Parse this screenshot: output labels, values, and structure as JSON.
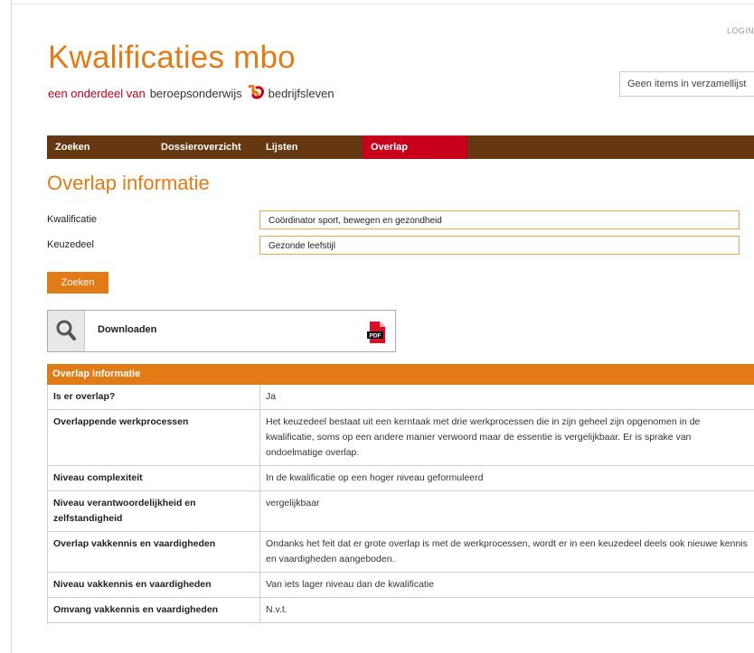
{
  "header": {
    "login": "LOGIN",
    "logo_title": "Kwalificaties mbo",
    "logo_sub_lead": "een onderdeel van",
    "logo_sub_mid": "beroepsonderwijs",
    "logo_sub_last": "bedrijfsleven",
    "collection": "Geen items in verzamellijst"
  },
  "nav": {
    "items": [
      "Zoeken",
      "Dossieroverzicht",
      "Lijsten",
      "Overlap"
    ],
    "active": "Overlap"
  },
  "page_title": "Overlap informatie",
  "form": {
    "kwalificatie_label": "Kwalificatie",
    "kwalificatie_value": "Coördinator sport, bewegen en gezondheid",
    "keuzedeel_label": "Keuzedeel",
    "keuzedeel_value": "Gezonde leefstijl",
    "search_button": "Zoeken"
  },
  "download": {
    "label": "Downloaden",
    "icon": "pdf-icon",
    "pdf_text": "PDF"
  },
  "table": {
    "header": "Overlap informatie",
    "rows": [
      {
        "label": "Is er overlap?",
        "value": "Ja"
      },
      {
        "label": "Overlappende werkprocessen",
        "value": "Het keuzedeel bestaat uit een kerntaak met drie werkprocessen die in zijn geheel zijn opgenomen in de kwalificatie, soms op een andere manier verwoord maar de essentie is vergelijkbaar. Er is sprake van ondoelmatige overlap."
      },
      {
        "label": "Niveau complexiteit",
        "value": "In de kwalificatie op een hoger niveau geformuleerd"
      },
      {
        "label": "Niveau verantwoordelijkheid en zelfstandigheid",
        "value": "vergelijkbaar"
      },
      {
        "label": "Overlap vakkennis en vaardigheden",
        "value": "Ondanks het feit dat er grote overlap is met de werkprocessen, wordt er in een keuzedeel deels ook nieuwe kennis en vaardigheden aangeboden."
      },
      {
        "label": "Niveau vakkennis en vaardigheden",
        "value": "Van iets lager niveau dan de kwalificatie"
      },
      {
        "label": "Omvang vakkennis en vaardigheden",
        "value": "N.v.t."
      }
    ]
  },
  "colors": {
    "orange": "#e07b16",
    "brown": "#653812",
    "red": "#c9001c"
  }
}
